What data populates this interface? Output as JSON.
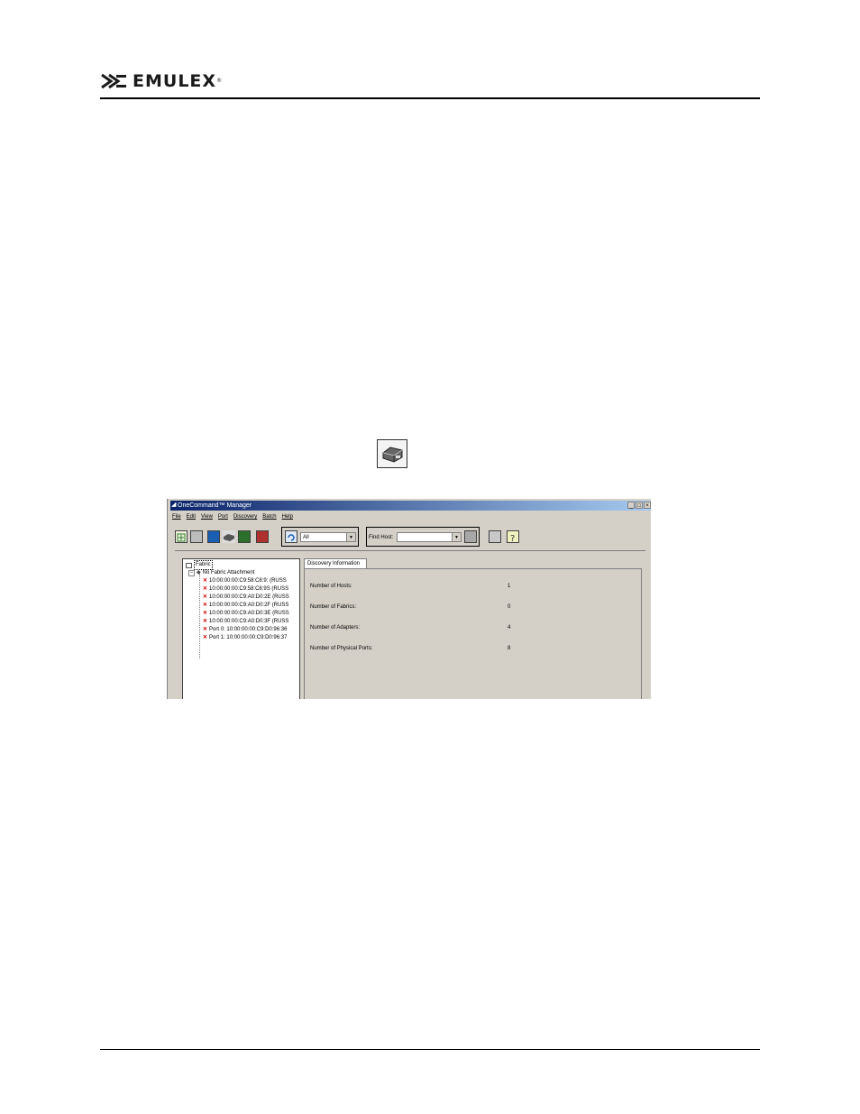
{
  "header": {
    "logo_text": "EMULEX",
    "logo_trademark": "®"
  },
  "inline_icon": "host-adapter-icon",
  "window": {
    "title": "OneCommand™ Manager",
    "controls": [
      "_",
      "□",
      "×"
    ],
    "menu": [
      "File",
      "Edit",
      "View",
      "Port",
      "Discovery",
      "Batch",
      "Help"
    ],
    "filter_value": "All",
    "find_host_label": "Find Host:",
    "find_host_value": ""
  },
  "tree": {
    "root": "Fabric",
    "group": "No Fabric Attachment",
    "items": [
      "10:00:00:00:C9:58:C8:9:  (RUSS",
      "10:00:00:00:C9:58:C8:9S  (RUSS",
      "10:00:00:00:C9:A0:D0:2E  (RUSS",
      "10:00:00:00:C9:A0:D0:2F  (RUSS",
      "10:00:00:00:C9:A0:D0:3E  (RUSS",
      "10:00:00:00:C9:A0:D0:3F  (RUSS",
      "Port 0: 10:00:00:00:C9:D0:96:36",
      "Port 1: 10:00:00:00:C9:D0:96:37"
    ]
  },
  "panel": {
    "tab_label": "Discovery Information",
    "rows": [
      {
        "label": "Number of Hosts:",
        "value": "1"
      },
      {
        "label": "Number of Fabrics:",
        "value": "0"
      },
      {
        "label": "Number of Adapters:",
        "value": "4"
      },
      {
        "label": "Number of Physical Ports:",
        "value": "8"
      }
    ]
  },
  "colors": {
    "titlebar_start": "#0a246a",
    "titlebar_end": "#a6caf0",
    "window_face": "#d4d0c8",
    "error_icon": "#cc0000"
  }
}
